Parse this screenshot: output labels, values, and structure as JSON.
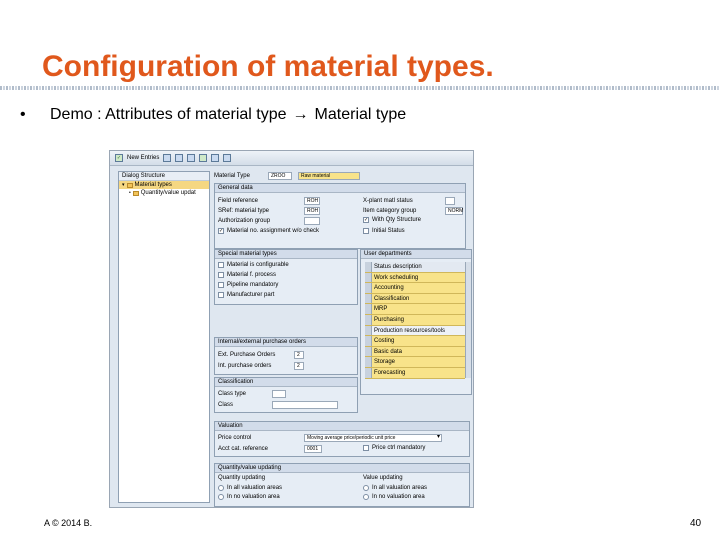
{
  "slide": {
    "title": "Configuration of material types.",
    "bullet": "•",
    "bullet_text_before": "Demo : Attributes of material type",
    "bullet_text_after": "Material type",
    "copyright": "A © 2014 B.",
    "page_number": "40",
    "accent_color": "#e0581c"
  },
  "sap": {
    "toolbar": {
      "new_entries": "New Entries"
    },
    "tree": {
      "header": "Dialog Structure",
      "items": [
        "Material types",
        "Quantity/value updat"
      ]
    },
    "material_type": {
      "label": "Material Type",
      "code": "ZROO",
      "description": "Raw material"
    },
    "general_data": {
      "title": "General data",
      "field_reference": {
        "label": "Field reference",
        "value": "ROH"
      },
      "srt_material_type": {
        "label": "SRef: material type",
        "value": "ROH"
      },
      "authorization_group": {
        "label": "Authorization group"
      },
      "with_qty_check": "Material no. assignment w/o check",
      "x_plant_status": {
        "label": "X-plant matl status"
      },
      "item_category_group": {
        "label": "Item category group",
        "value": "NORM"
      },
      "with_qty_structure": "With Qty Structure",
      "initial_status": "Initial Status"
    },
    "special_material_types": {
      "title": "Special material types",
      "items": [
        "Material is configurable",
        "Material f. process",
        "Pipeline mandatory",
        "Manufacturer part"
      ]
    },
    "user_departments": {
      "title": "User departments",
      "header": "Status description",
      "rows": [
        "Work scheduling",
        "Accounting",
        "Classification",
        "MRP",
        "Purchasing",
        "Production resources/tools",
        "Costing",
        "Basic data",
        "Storage",
        "Forecasting"
      ],
      "highlighted": [
        true,
        true,
        true,
        true,
        true,
        false,
        true,
        true,
        true,
        true
      ]
    },
    "purchase_orders": {
      "title": "Internal/external purchase orders",
      "ext": {
        "label": "Ext. Purchase Orders",
        "value": "2"
      },
      "int": {
        "label": "Int. purchase orders",
        "value": "2"
      }
    },
    "classification": {
      "title": "Classification",
      "class_type": "Class type",
      "class": "Class"
    },
    "valuation": {
      "title": "Valuation",
      "price_control": {
        "label": "Price control",
        "value": "Moving average price/periodic unit price"
      },
      "acct_cat_ref": {
        "label": "Acct cat. reference",
        "value": "0001"
      },
      "price_ctrl_mandatory": "Price ctrl mandatory"
    },
    "qty_value_updating": {
      "title": "Quantity/value updating",
      "qty_label": "Quantity updating",
      "value_label": "Value updating",
      "qty_options": [
        "In all valuation areas",
        "In no valuation area"
      ],
      "value_options": [
        "In all valuation areas",
        "In no valuation area"
      ]
    }
  }
}
